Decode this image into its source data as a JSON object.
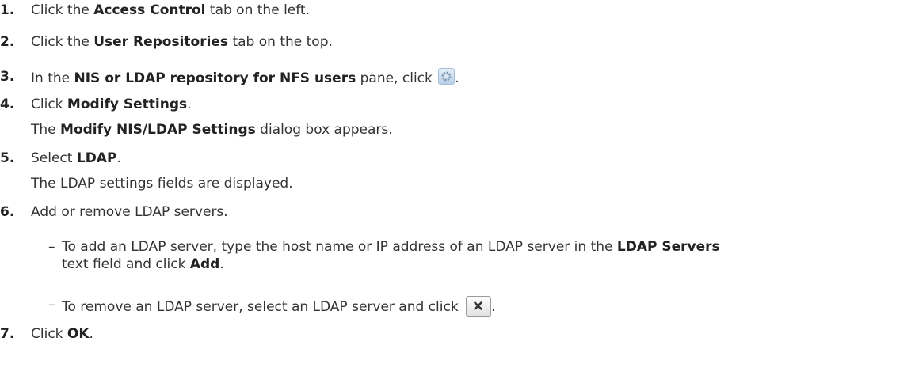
{
  "steps": [
    {
      "num": "1.",
      "pre": "Click the ",
      "bold": "Access Control",
      "post": " tab on the left."
    },
    {
      "num": "2.",
      "pre": "Click the ",
      "bold": "User Repositories",
      "post": " tab on the top."
    },
    {
      "num": "3.",
      "pre": "In the ",
      "bold": "NIS or LDAP repository for NFS users",
      "post": " pane, click ",
      "end": ".",
      "icon": "gear-icon"
    },
    {
      "num": "4.",
      "pre": "Click ",
      "bold": "Modify Settings",
      "post": ".",
      "result_pre": "The ",
      "result_bold": "Modify NIS/LDAP Settings",
      "result_post": " dialog box appears."
    },
    {
      "num": "5.",
      "pre": "Select ",
      "bold": "LDAP",
      "post": ".",
      "result": "The LDAP settings fields are displayed."
    },
    {
      "num": "6.",
      "text": "Add or remove LDAP servers.",
      "subitems": [
        {
          "dash": "–",
          "pre": "To add an LDAP server, type the host name or IP address of an LDAP server in the ",
          "bold": "LDAP Servers",
          "line2_pre": "text field and click ",
          "line2_bold": "Add",
          "line2_post": "."
        },
        {
          "dash": "–",
          "pre": "To remove an LDAP server, select an LDAP server and click ",
          "end": ".",
          "icon": "close-icon"
        }
      ]
    },
    {
      "num": "7.",
      "pre": "Click ",
      "bold": "OK",
      "post": "."
    }
  ]
}
